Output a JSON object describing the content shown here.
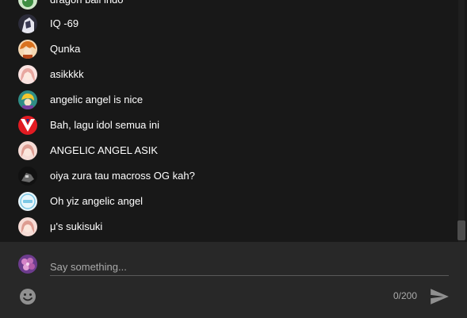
{
  "messages": [
    {
      "author_avatar": "green-cartoon-avatar",
      "text": "dragon ball indo"
    },
    {
      "author_avatar": "dark-anime-avatar",
      "text": "IQ -69"
    },
    {
      "author_avatar": "orange-hair-avatar",
      "text": "Qunka"
    },
    {
      "author_avatar": "pink-anime-girl-avatar",
      "text": "asikkkk"
    },
    {
      "author_avatar": "teal-yellow-anime-avatar",
      "text": "angelic angel is nice"
    },
    {
      "author_avatar": "red-white-logo-avatar",
      "text": "Bah, lagu idol semua ini"
    },
    {
      "author_avatar": "pink-anime-girl-avatar",
      "text": "ANGELIC ANGEL ASIK"
    },
    {
      "author_avatar": "dark-mecha-avatar",
      "text": "oiya zura tau macross OG kah?"
    },
    {
      "author_avatar": "light-blue-text-avatar",
      "text": "Oh yiz angelic angel"
    },
    {
      "author_avatar": "pink-anime-girl-avatar",
      "text": "μ's sukisuki"
    }
  ],
  "input": {
    "placeholder": "Say something...",
    "value": "",
    "char_count": "0/200",
    "self_avatar": "purple-flower-avatar"
  },
  "icons": {
    "emoji": "smiley-face-icon",
    "send": "send-arrow-icon"
  },
  "colors": {
    "chat_background": "#181818",
    "input_panel_background": "#282828",
    "message_text": "#ffffff",
    "placeholder_text": "#aaaaaa",
    "icon_color": "#909090"
  }
}
